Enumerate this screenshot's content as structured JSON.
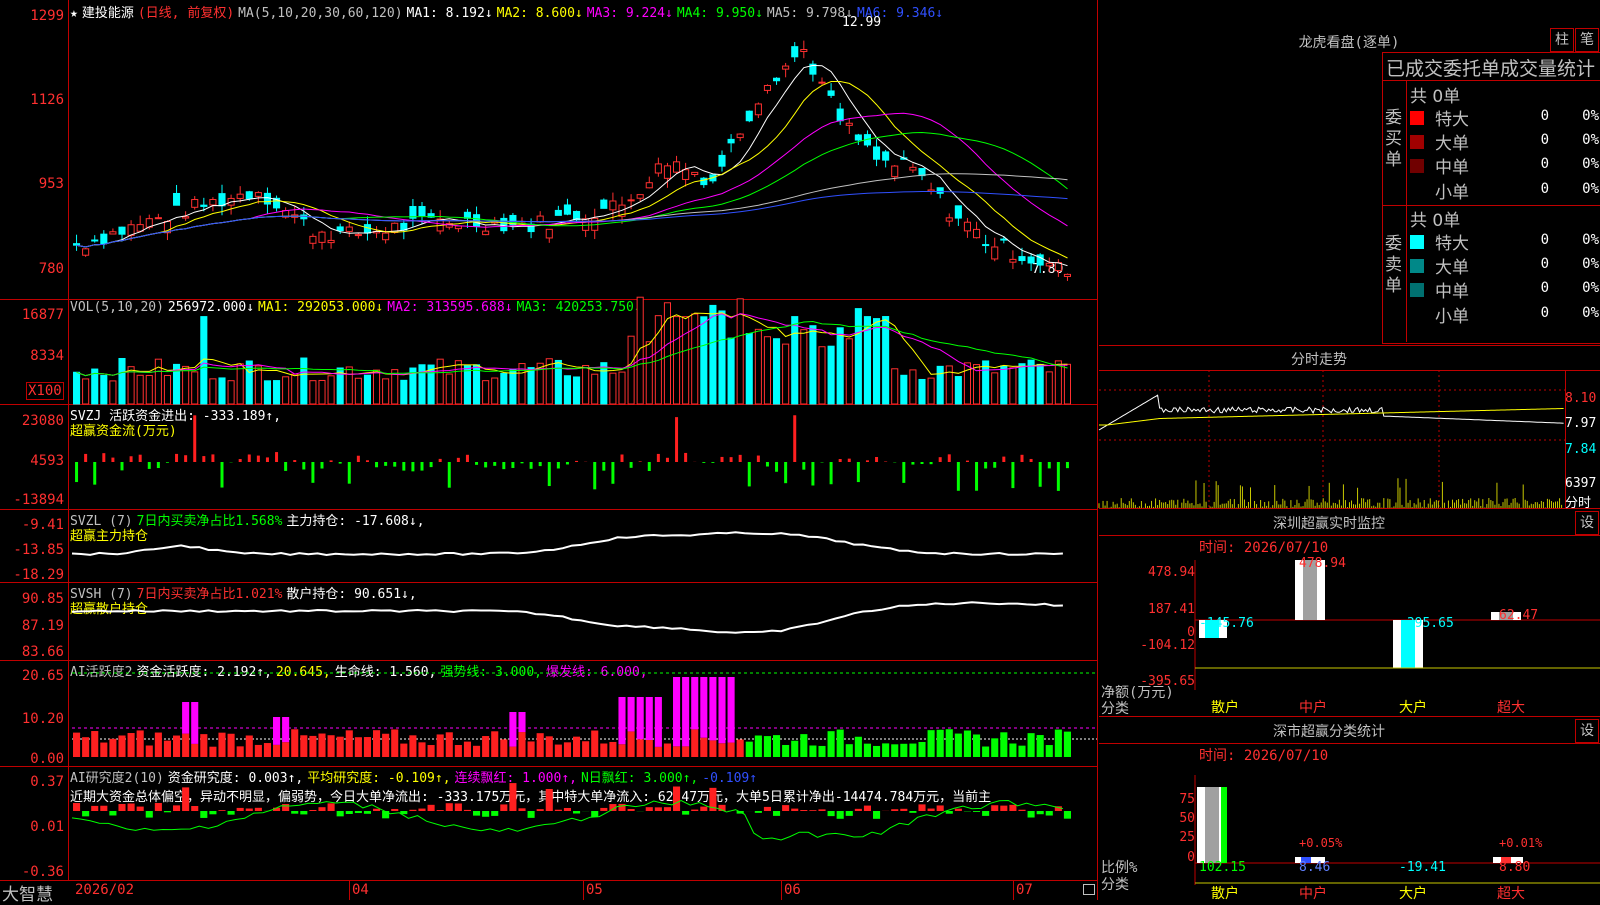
{
  "stock": {
    "name": "建投能源",
    "mode": "(日线, 前复权)",
    "ma_label": "MA(5,10,20,30,60,120)",
    "ma1": "MA1: 8.192↓",
    "ma2": "MA2: 8.600↓",
    "ma3": "MA3: 9.224↓",
    "ma4": "MA4: 9.950↓",
    "ma5": "MA5: 9.798↓",
    "ma6": "MA6: 9.346↓",
    "high_mark": "12.99",
    "low_mark": "7.80"
  },
  "price_axis": [
    "1299",
    "1126",
    "953",
    "780"
  ],
  "vol": {
    "legend": "VOL(5,10,20)",
    "val": "256972.000↓",
    "ma1": "MA1: 292053.000↓",
    "ma2": "MA2: 313595.688↓",
    "ma3": "MA3: 420253.750↓",
    "axis": [
      "16877",
      "8334"
    ],
    "unit": "X100"
  },
  "svzj": {
    "legend": "SVZJ  活跃资金进出: -333.189↑,",
    "sub": "超赢资金流(万元)",
    "axis": [
      "23080",
      "4593",
      "-13894"
    ]
  },
  "svzl": {
    "legend1": "SVZL (7)",
    "legend2": "7日内买卖净占比1.568%",
    "legend3": "主力持仓: -17.608↓,",
    "sub": "超赢主力持仓",
    "axis": [
      "-9.41",
      "-13.85",
      "-18.29"
    ]
  },
  "svsh": {
    "legend1": "SVSH (7)",
    "legend2": "7日内买卖净占比1.021%",
    "legend3": "散户持仓: 90.651↓,",
    "sub": "超赢散户持仓",
    "axis": [
      "90.85",
      "87.19",
      "83.66"
    ]
  },
  "ai1": {
    "l1": "AI活跃度2",
    "l2": "资金活跃度: 2.192↑,",
    "l3": "20.645,",
    "l4": "生命线: 1.560,",
    "l5": "强势线: 3.000,",
    "l6": "爆发线: 6.000,",
    "axis": [
      "20.65",
      "10.20",
      "0.00"
    ]
  },
  "ai2": {
    "l1": "AI研究度2(10)",
    "l2": "资金研究度: 0.003↑,",
    "l3": "平均研究度: -0.109↑,",
    "l4": "连续飘红: 1.000↑,",
    "l5": "N日飘红: 3.000↑,",
    "l6": "-0.109↑",
    "text": "近期大资金总体偏空，异动不明显，偏弱势，今日大单净流出: -333.175万元，其中特大单净流入: 62.47万元，大单5日累计净出-14474.784万元，当前主",
    "axis": [
      "0.37",
      "0.01",
      "-0.36"
    ]
  },
  "footer": {
    "logo": "大智慧",
    "dates": [
      "2026/02",
      "04",
      "05",
      "06",
      "07"
    ]
  },
  "lhb": {
    "title": "龙虎看盘(逐单)",
    "btn1": "柱",
    "btn2": "笔",
    "tabs": "已成交委托单成交量统计",
    "buy_total": "共 0单",
    "sell_total": "共 0单",
    "buy_label": "委买单",
    "sell_label": "委卖单",
    "rows": [
      "特大",
      "大单",
      "中单",
      "小单"
    ],
    "zero": "0",
    "pct": "0%"
  },
  "fenshi": {
    "title": "分时走势",
    "axis": [
      "8.10",
      "7.97",
      "7.84"
    ],
    "vol": "6397",
    "unit": "分时"
  },
  "szmon": {
    "title": "深圳超赢实时监控",
    "btn": "设",
    "time": "时间: 2026/07/10",
    "axis": [
      "478.94",
      "187.41",
      "0",
      "-104.12",
      "-395.65"
    ],
    "ylabel1": "净额(万元)",
    "ylabel2": "分类",
    "cats": [
      "散户",
      "中户",
      "大户",
      "超大"
    ],
    "vals": [
      "-145.76",
      "478.94",
      "-395.65",
      "62.47"
    ]
  },
  "szcls": {
    "title": "深市超赢分类统计",
    "btn": "设",
    "time": "时间: 2026/07/10",
    "axis": [
      "75",
      "50",
      "25",
      "0"
    ],
    "ylabel1": "比例%",
    "ylabel2": "分类",
    "cats": [
      "散户",
      "中户",
      "大户",
      "超大"
    ],
    "vals": [
      "102.15",
      "8.46",
      "-19.41",
      "8.80"
    ],
    "pcts": [
      "+0.05%",
      "+0.01%"
    ]
  }
}
